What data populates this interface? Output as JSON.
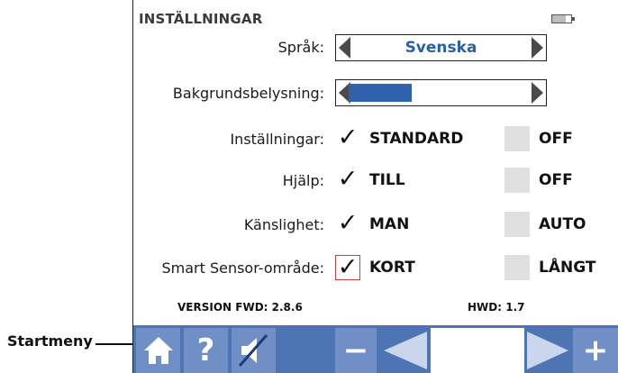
{
  "callout": {
    "label": "Startmeny"
  },
  "header": {
    "title": "INSTÄLLNINGAR",
    "battery_level": 0.7
  },
  "language": {
    "label": "Språk:",
    "value": "Svenska"
  },
  "backlight": {
    "label": "Bakgrundsbelysning:",
    "level": 0.35
  },
  "rows": [
    {
      "label": "Inställningar:",
      "option_a": "STANDARD",
      "option_b": "OFF",
      "a_checked": true,
      "b_checked": false
    },
    {
      "label": "Hjälp:",
      "option_a": "TILL",
      "option_b": "OFF",
      "a_checked": true,
      "b_checked": false
    },
    {
      "label": "Känslighet:",
      "option_a": "MAN",
      "option_b": "AUTO",
      "a_checked": true,
      "b_checked": false
    },
    {
      "label": "Smart Sensor-område:",
      "option_a": "KORT",
      "option_b": "LÅNGT",
      "a_checked": true,
      "b_checked": false
    }
  ],
  "version": {
    "fwd": "VERSION FWD: 2.8.6",
    "hwd": "HWD: 1.7"
  },
  "toolbar": {
    "help_glyph": "?",
    "minus_glyph": "−",
    "plus_glyph": "+"
  },
  "colors": {
    "accent": "#2f62ab",
    "toolbar": "#4d74b3",
    "toolbar_button": "#6f8fc6",
    "focus": "#d23b3b"
  }
}
